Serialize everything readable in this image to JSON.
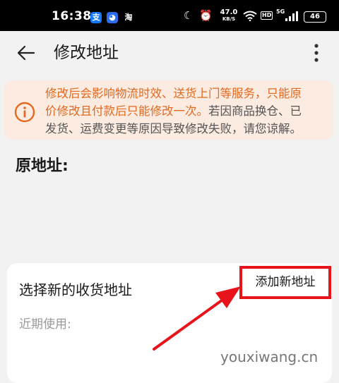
{
  "status_bar": {
    "time": "16:38",
    "apps": [
      "支",
      "淘"
    ],
    "net_speed_value": "47.0",
    "net_speed_unit": "KB/S",
    "hd_label": "HD",
    "network_label": "5G",
    "battery": "46"
  },
  "header": {
    "title": "修改地址"
  },
  "notice": {
    "line1": "修改后会影响物流时效、送货上门等服务，只能原",
    "line2_orange": "价修改且付款后只能修改一次。",
    "line2_grey": "若因商品换仓、已",
    "line3": "发货、运费变更等原因导致修改失败，请您谅解。",
    "accent_color": "#e3691f"
  },
  "original_address": {
    "label": "原地址:"
  },
  "new_address_card": {
    "title": "选择新的收货地址",
    "add_button": "添加新地址",
    "recent_label": "近期使用:"
  },
  "watermark": "youxiwang.cn",
  "annotation_color": "#e8141c"
}
